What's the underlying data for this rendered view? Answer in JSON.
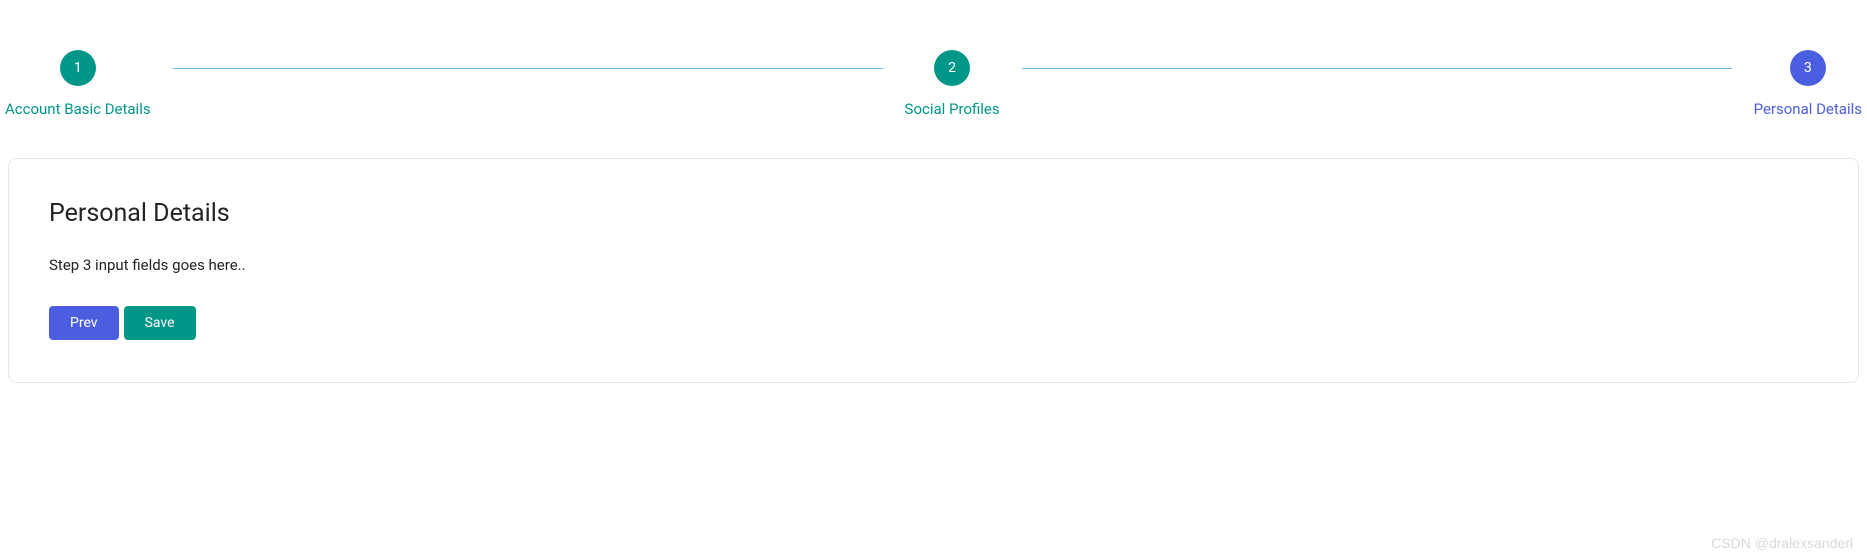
{
  "stepper": {
    "steps": [
      {
        "number": "1",
        "label": "Account Basic Details",
        "state": "completed"
      },
      {
        "number": "2",
        "label": "Social Profiles",
        "state": "completed"
      },
      {
        "number": "3",
        "label": "Personal Details",
        "state": "active"
      }
    ]
  },
  "card": {
    "title": "Personal Details",
    "body": "Step 3 input fields goes here..",
    "prev_label": "Prev",
    "save_label": "Save"
  },
  "watermark": "CSDN @dralexsanderl"
}
